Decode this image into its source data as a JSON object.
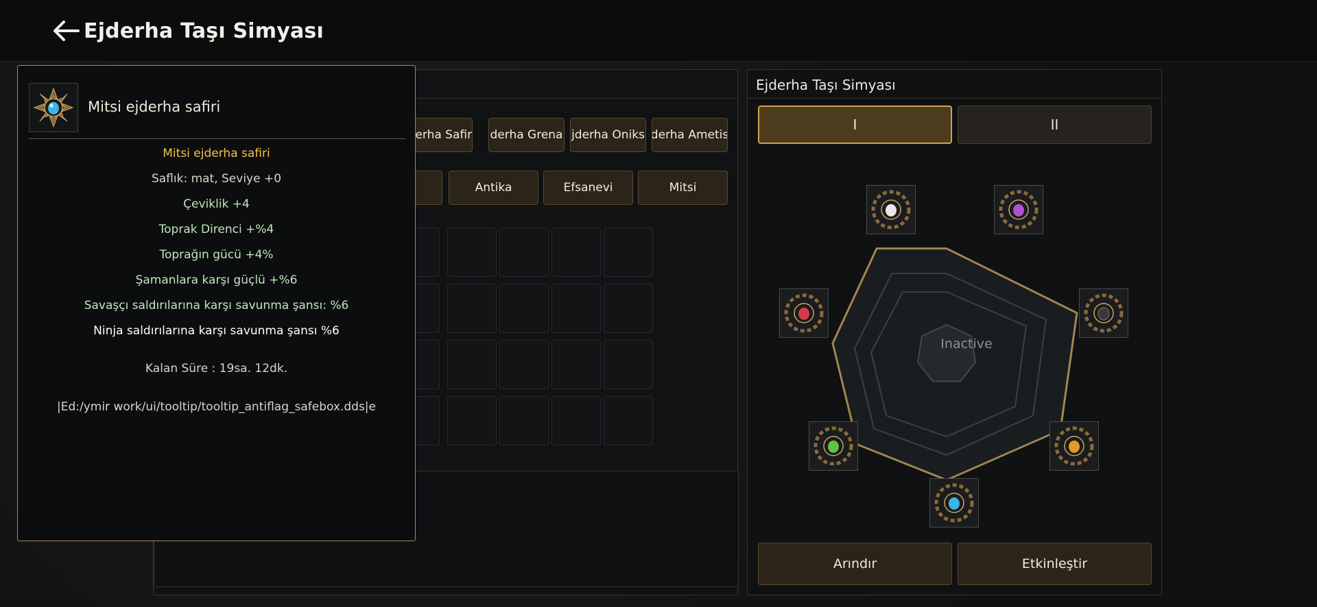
{
  "header": {
    "title": "Ejderha Taşı Simyası"
  },
  "middle": {
    "stone_tabs": [
      "jderha Safir",
      "derha Grena",
      "jderha Oniks",
      "derha Ametis"
    ],
    "grade_tabs": [
      "Antika",
      "Efsanevi",
      "Mitsi"
    ]
  },
  "tooltip": {
    "item_name": "Mitsi ejderha safiri",
    "lines": {
      "title": "Mitsi ejderha safiri",
      "purity": "Saflık: mat, Seviye +0",
      "agility": "Çeviklik +4",
      "earth_resist": "Toprak Direnci +%4",
      "earth_power": "Toprağın gücü +4%",
      "vs_shaman": "Şamanlara karşı güçlü +%6",
      "vs_warrior": "Savaşçı saldırılarına karşı savunma şansı: %6",
      "vs_ninja": "Ninja saldırılarına karşı savunma şansı %6",
      "time_left": "Kalan Süre : 19sa. 12dk.",
      "debug_path": "|Ed:/ymir work/ui/tooltip/tooltip_antiflag_safebox.dds|e"
    }
  },
  "right": {
    "title": "Ejderha Taşı Simyası",
    "page_tabs": [
      "I",
      "II"
    ],
    "center_status": "Inactive",
    "refine_label": "Arındır",
    "activate_label": "Etkinleştir",
    "slot_gems": [
      {
        "name": "diamond",
        "color": "#e8e8e8"
      },
      {
        "name": "amethyst",
        "color": "#b04fd6"
      },
      {
        "name": "onyx",
        "color": "#3a3a3a"
      },
      {
        "name": "garnet-orange",
        "color": "#e39a2a"
      },
      {
        "name": "sapphire",
        "color": "#3cb4e6"
      },
      {
        "name": "jade",
        "color": "#5fc24a"
      },
      {
        "name": "ruby",
        "color": "#d63a4a"
      }
    ]
  },
  "colors": {
    "accent_gold": "#d0a24f",
    "tooltip_border": "#a68a54",
    "title_yellow": "#f3c347",
    "stat_green": "#bfe8bf"
  }
}
